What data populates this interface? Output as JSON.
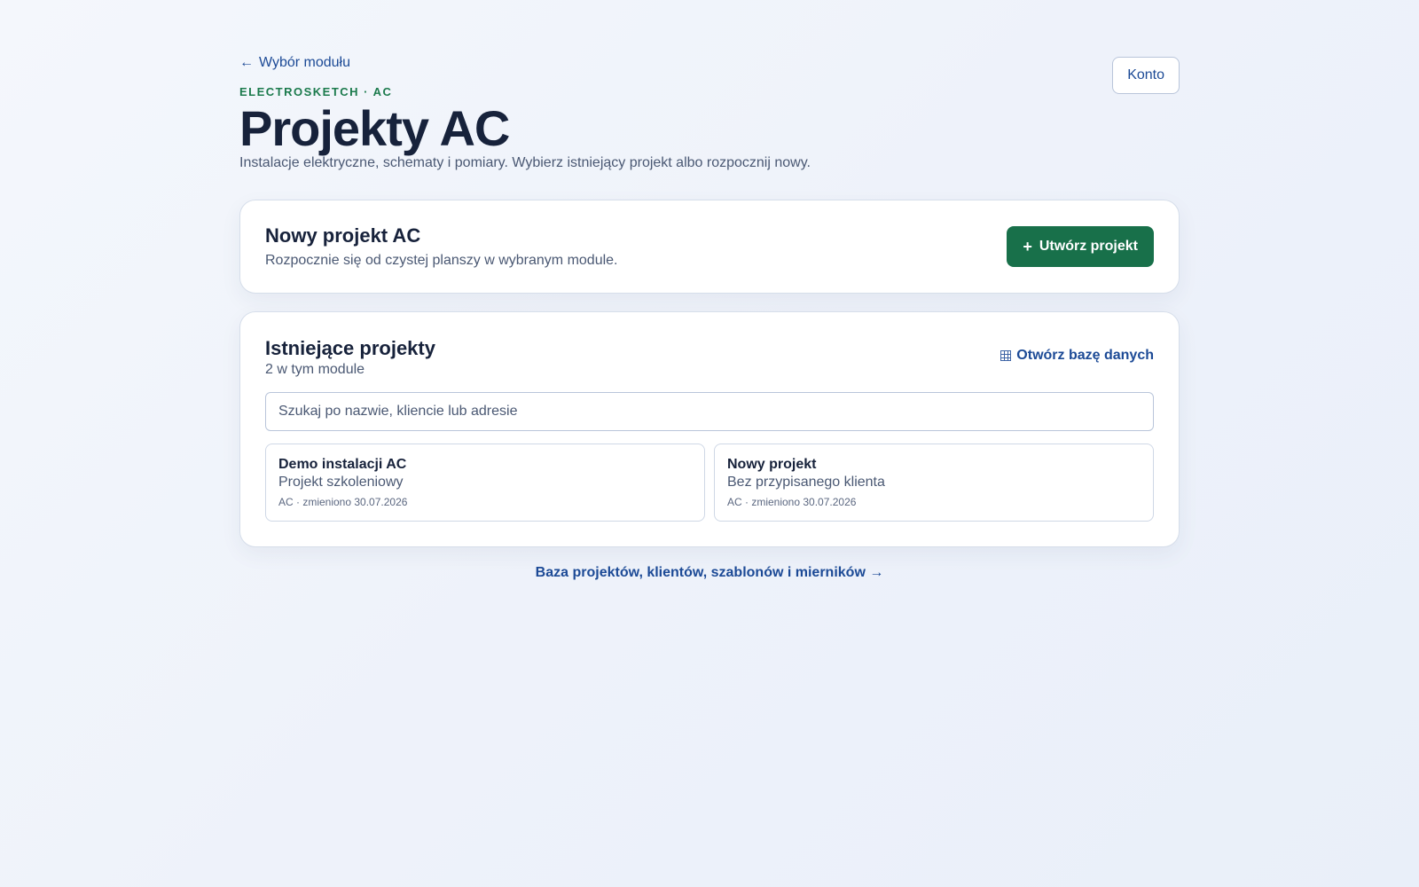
{
  "header": {
    "back_label": "Wybór modułu",
    "back_icon": "arrow-left-icon",
    "account_label": "Konto",
    "eyebrow": "ELECTROSKETCH · AC",
    "title": "Projekty AC",
    "subtitle": "Instalacje elektryczne, schematy i pomiary. Wybierz istniejący projekt albo rozpocznij nowy."
  },
  "new_project": {
    "title": "Nowy projekt AC",
    "description": "Rozpocznie się od czystej planszy w wybranym module.",
    "button_label": "Utwórz projekt",
    "button_icon": "plus-icon"
  },
  "existing": {
    "title": "Istniejące projekty",
    "count_label": "2 w tym module",
    "db_link_label": "Otwórz bazę danych",
    "db_link_icon": "grid-icon",
    "search_placeholder": "Szukaj po nazwie, kliencie lub adresie",
    "projects": [
      {
        "name": "Demo instalacji AC",
        "client": "Projekt szkoleniowy",
        "meta": "AC · zmieniono 30.07.2026"
      },
      {
        "name": "Nowy projekt",
        "client": "Bez przypisanego klienta",
        "meta": "AC · zmieniono 30.07.2026"
      }
    ]
  },
  "footer": {
    "link_label": "Baza projektów, klientów, szablonów i mierników →"
  },
  "colors": {
    "accent_green": "#18704a",
    "eyebrow_green": "#1b7a4c",
    "link_blue": "#1c4a96",
    "heading": "#17223b",
    "muted": "#4a5873"
  }
}
